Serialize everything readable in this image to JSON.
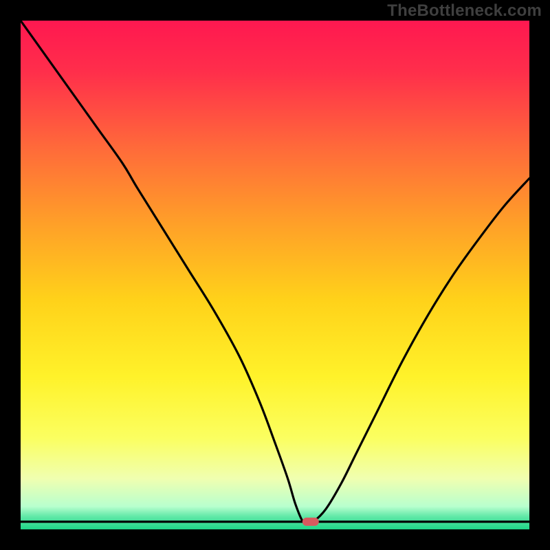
{
  "watermark": "TheBottleneck.com",
  "chart_data": {
    "type": "line",
    "title": "",
    "xlabel": "",
    "ylabel": "",
    "xlim": [
      0,
      100
    ],
    "ylim": [
      0,
      100
    ],
    "grid": false,
    "legend": false,
    "series": [
      {
        "name": "bottleneck-curve",
        "x": [
          0,
          5,
          10,
          15,
          20,
          23,
          28,
          33,
          38,
          43,
          47,
          50,
          52.5,
          54,
          55.5,
          56.5,
          57.5,
          60,
          63,
          66,
          70,
          75,
          80,
          85,
          90,
          95,
          100
        ],
        "y": [
          100,
          93,
          86,
          79,
          72,
          67,
          59,
          51,
          43,
          34,
          25,
          17,
          10,
          5,
          1.5,
          1.5,
          1.5,
          4,
          9,
          15,
          23,
          33,
          42,
          50,
          57,
          63.5,
          69
        ]
      }
    ],
    "baseline": {
      "x": [
        0,
        100
      ],
      "y": [
        1.5,
        1.5
      ]
    },
    "marker": {
      "x": 57,
      "y": 1.5,
      "color": "#d85a5f"
    },
    "gradient_stops": [
      {
        "offset": 0.0,
        "color": "#ff1850"
      },
      {
        "offset": 0.1,
        "color": "#ff2e4b"
      },
      {
        "offset": 0.25,
        "color": "#ff6a3a"
      },
      {
        "offset": 0.4,
        "color": "#ffa028"
      },
      {
        "offset": 0.55,
        "color": "#ffd21a"
      },
      {
        "offset": 0.7,
        "color": "#fff22a"
      },
      {
        "offset": 0.82,
        "color": "#fbff60"
      },
      {
        "offset": 0.9,
        "color": "#f0ffb0"
      },
      {
        "offset": 0.955,
        "color": "#b8ffce"
      },
      {
        "offset": 0.975,
        "color": "#5fe8a7"
      },
      {
        "offset": 1.0,
        "color": "#1fd687"
      }
    ]
  }
}
